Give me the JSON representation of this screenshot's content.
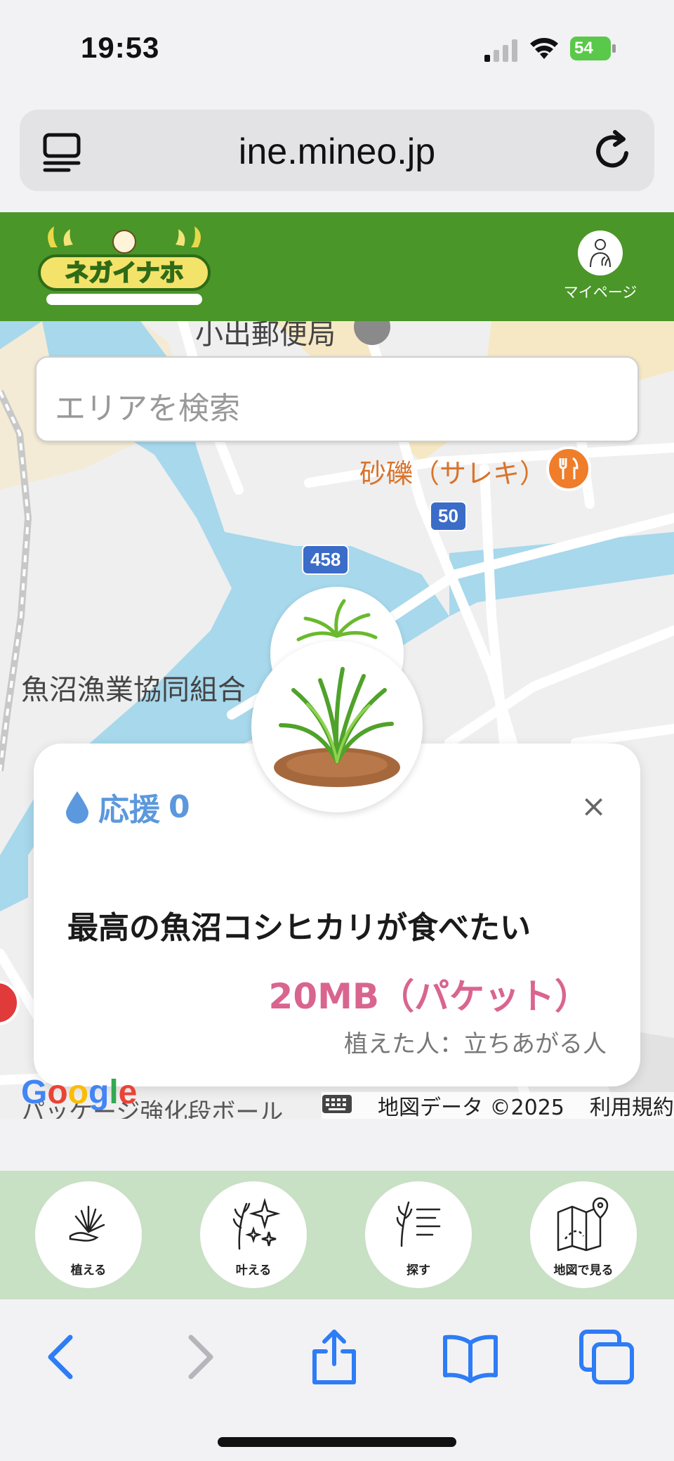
{
  "status_bar": {
    "time": "19:53",
    "battery": "54"
  },
  "browser": {
    "url": "ine.mineo.jp"
  },
  "app": {
    "mypage_label": "マイページ"
  },
  "map": {
    "search_placeholder": "エリアを検索",
    "labels": {
      "post_office": "小出郵便局",
      "restaurant": "砂礫（サレキ）",
      "fishery": "魚沼漁業協同組合",
      "route_50": "50",
      "route_458": "458",
      "bottom_text": "パッケージ強化段ボール"
    },
    "attribution": {
      "google": "Google",
      "map_data": "地図データ ©2025",
      "terms": "利用規約"
    }
  },
  "card": {
    "support_label": "応援",
    "support_count": "0",
    "close": "×",
    "wish": "最高の魚沼コシヒカリが食べたい",
    "reward": "20MB（パケット）",
    "planter": "植えた人：立ちあがる人"
  },
  "nav": [
    {
      "label": "植える"
    },
    {
      "label": "叶える"
    },
    {
      "label": "探す"
    },
    {
      "label": "地図で見る"
    }
  ],
  "colors": {
    "header_green": "#4a9628",
    "nav_green": "#c8e0c4",
    "reward_pink": "#d9658f",
    "support_blue": "#5b98dd",
    "safari_blue": "#2e7cf6"
  }
}
